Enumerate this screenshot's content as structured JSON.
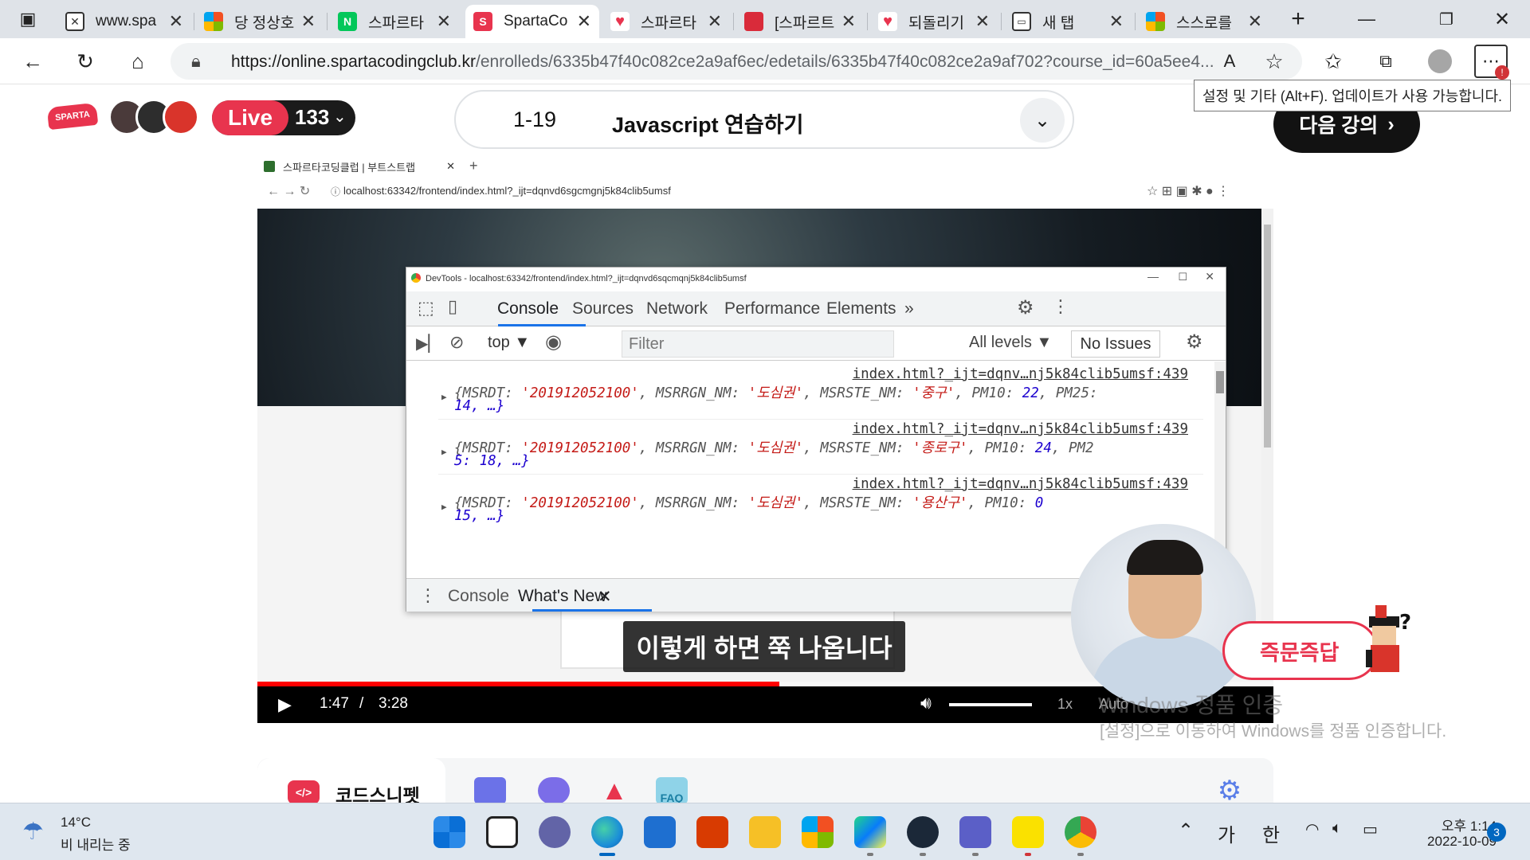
{
  "browser": {
    "tabs": [
      {
        "title": "",
        "icon": "tab-actions-icon"
      },
      {
        "title": "www.spa",
        "icon": "blocked-page-icon"
      },
      {
        "title": "당 정상호",
        "icon": "microsoft-icon"
      },
      {
        "title": "스파르타",
        "icon": "naver-icon"
      },
      {
        "title": "SpartaCo",
        "icon": "sparta-icon"
      },
      {
        "title": "스파르타",
        "icon": "heart-icon"
      },
      {
        "title": "[스파르트",
        "icon": "book-icon"
      },
      {
        "title": "되돌리기",
        "icon": "heart-icon"
      },
      {
        "title": "새 탭",
        "icon": "new-tab-icon"
      },
      {
        "title": "스스로를",
        "icon": "microsoft-icon"
      }
    ],
    "url_host": "https://online.spartacodingclub.kr",
    "url_path": "/enrolleds/6335b47f40c082ce2a9af6ec/edetails/6335b47f40c082ce2a9af702?course_id=60a5ee4...",
    "tooltip": "설정 및 기타 (Alt+F). 업데이트가 사용 가능합니다.",
    "update_badge": "!"
  },
  "header": {
    "logo": "SPARTA",
    "live_label": "Live",
    "live_count": "133",
    "lesson_number": "1-19",
    "lesson_title": "Javascript 연습하기",
    "next_label": "다음 강의"
  },
  "video": {
    "inner_tab_title": "스파르타코딩클럽 | 부트스트랩",
    "inner_url": "localhost:63342/frontend/index.html?_ijt=dqnvd6sgcmgnj5k84clib5umsf",
    "devtools": {
      "title": "DevTools - localhost:63342/frontend/index.html?_ijt=dqnvd6sqcmqnj5k84clib5umsf",
      "tabs": [
        "Console",
        "Sources",
        "Network",
        "Performance",
        "Elements"
      ],
      "context": "top",
      "filter_placeholder": "Filter",
      "levels": "All levels",
      "issues": "No Issues",
      "logs": [
        {
          "source": "index.html?_ijt=dqnv…nj5k84clib5umsf:439",
          "msrdt": "'201912052100'",
          "rgn": "'도심권'",
          "ste": "'중구'",
          "pm10": "22",
          "pm25_key": "PM25:",
          "tail": "14, …}"
        },
        {
          "source": "index.html?_ijt=dqnv…nj5k84clib5umsf:439",
          "msrdt": "'201912052100'",
          "rgn": "'도심권'",
          "ste": "'종로구'",
          "pm10": "24",
          "pm25_key": "PM2",
          "tail": "5: 18, …}"
        },
        {
          "source": "index.html?_ijt=dqnv…nj5k84clib5umsf:439",
          "msrdt": "'201912052100'",
          "rgn": "'도심권'",
          "ste": "'용산구'",
          "pm10": "0",
          "pm25_key": "",
          "tail": "15, …}"
        }
      ],
      "drawer_tabs": [
        "Console",
        "What's New"
      ]
    },
    "caption": "이렇게 하면 쭉 나옵니다",
    "time_current": "1:47",
    "time_separator": "/",
    "time_total": "3:28",
    "progress": 0.514,
    "speed": "1x",
    "quality": "Auto",
    "qa_badge": "즉문즉답"
  },
  "watermark": {
    "line1": "Windows 정품 인증",
    "line2": "[설정]으로 이동하여 Windows를 정품 인증합니다."
  },
  "page_tools": {
    "snippet_icon": "</>",
    "snippet_label": "코드스니펫",
    "faq_label": "FAQ"
  },
  "taskbar": {
    "weather_temp": "14°C",
    "weather_desc": "비 내리는 중",
    "ime_1": "가",
    "ime_2": "한",
    "clock_time": "오후 1:14",
    "clock_date": "2022-10-09",
    "notifications": "3",
    "apps": [
      "start-icon",
      "task-view-icon",
      "chat-icon",
      "edge-icon",
      "mail-icon",
      "office-icon",
      "file-explorer-icon",
      "store-icon",
      "pycharm-icon",
      "steam-icon",
      "teams-icon",
      "kakaotalk-icon",
      "chrome-icon"
    ]
  }
}
